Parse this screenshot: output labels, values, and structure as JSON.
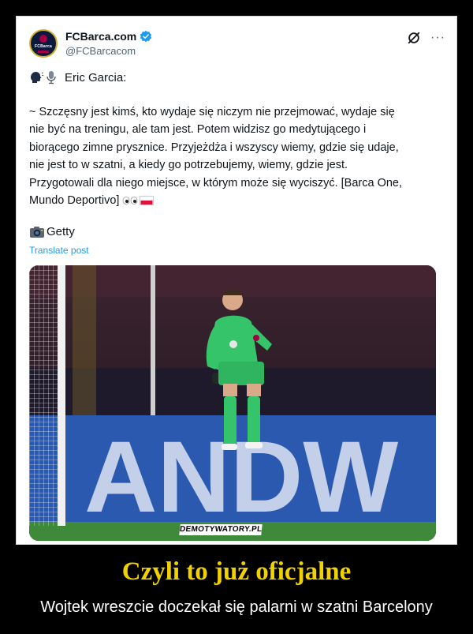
{
  "tweet": {
    "author": {
      "display_name": "FCBarca.com",
      "handle": "@FCBarcacom",
      "avatar_text": "FCBarca"
    },
    "speaker": "Eric Garcia:",
    "body": "~ Szczęsny jest kimś, kto wydaje się niczym nie przejmować, wydaje się\nnie być na treningu, ale tam jest. Potem widzisz go medytującego i\nbiorącego zimne prysznice. Przyjeżdża i wszyscy wiemy, gdzie się udaje,\nnie jest to w szatni, a kiedy go potrzebujemy, wiemy, gdzie jest.\nPrzygotowali dla niego miejsce, w którym może się wyciszyć. [Barca One,\nMundo Deportivo]",
    "credit": "Getty",
    "translate_label": "Translate post",
    "more_label": "···",
    "photo": {
      "board_text": "ANDW"
    }
  },
  "watermark": "DEMOTYWATORY.PL",
  "caption": {
    "title": "Czyli to już oficjalne",
    "subtitle": "Wojtek wreszcie doczekał się palarni w szatni Barcelony"
  },
  "colors": {
    "verified": "#1d9bf0",
    "link": "#1d9bf0",
    "caption_title": "#f0d200",
    "kit_green": "#35c46a",
    "board_blue": "#2b59b0"
  },
  "icons": [
    "verified-badge-icon",
    "grok-icon",
    "more-icon",
    "speaking-head-icon",
    "microphone-icon",
    "eyes-icon",
    "poland-flag-icon",
    "camera-icon"
  ]
}
